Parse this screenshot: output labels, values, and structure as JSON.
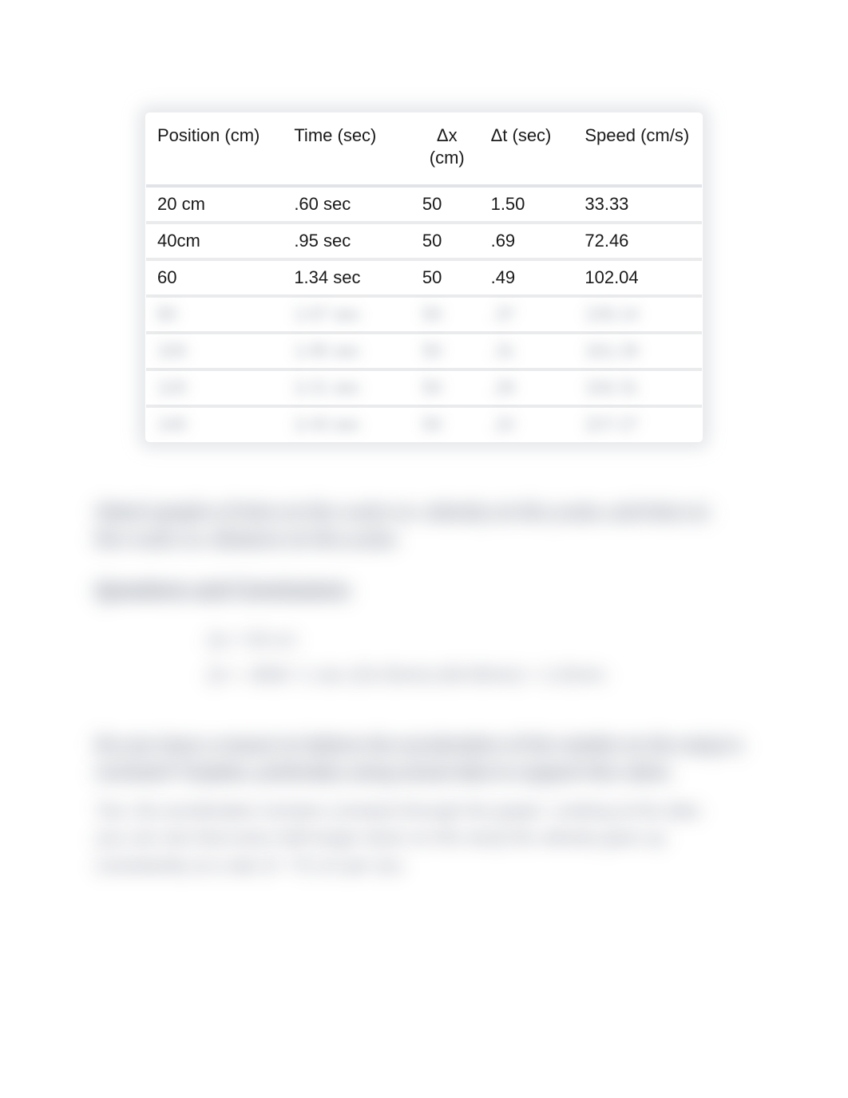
{
  "table": {
    "headers": [
      "Position (cm)",
      "Time (sec)",
      "Δx (cm)",
      "Δt (sec)",
      "Speed (cm/s)"
    ],
    "rows": [
      {
        "position": "20 cm",
        "time": ".60 sec",
        "dx": "50",
        "dt": "1.50",
        "speed": "33.33",
        "obscured": false
      },
      {
        "position": "40cm",
        "time": ".95 sec",
        "dx": "50",
        "dt": ".69",
        "speed": "72.46",
        "obscured": false
      },
      {
        "position": "60",
        "time": "1.34 sec",
        "dx": "50",
        "dt": ".49",
        "speed": "102.04",
        "obscured": false
      },
      {
        "position": "80",
        "time": "1.67 sec",
        "dx": "50",
        "dt": ".37",
        "speed": "135.14",
        "obscured": true
      },
      {
        "position": "100",
        "time": "1.95 sec",
        "dx": "50",
        "dt": ".31",
        "speed": "161.29",
        "obscured": true
      },
      {
        "position": "120",
        "time": "2.21 sec",
        "dx": "50",
        "dt": ".26",
        "speed": "192.31",
        "obscured": true
      },
      {
        "position": "140",
        "time": "2.43 sec",
        "dx": "50",
        "dt": ".22",
        "speed": "227.27",
        "obscured": true
      }
    ]
  },
  "paragraphs": {
    "p1_line1": "Attach graphs of time on the x-axis vs. velocity on the y-axis, and time on",
    "p1_line2": "the x-axis vs. distance on the y-axis.",
    "heading": "Questions and Conclusions",
    "indent1": "Δx = 50 cm",
    "indent2": "Δt = .4900 / 1 sec (33.33m/s) (60.90m/s) = 1.02m/s",
    "p2_line1": "Do you have a reason to believe the acceleration of the marble on the ramp is",
    "p2_line2": "constant?       Explain, preferably using           actual data      to support this claim.",
    "p3_line1": "Yes, the acceleration remains constant through the graph. Looking at the data",
    "p3_line2": "you can see that every half longer down on the ramp the velocity goes up",
    "p3_line3": "consistently at a rate of ~75 cm per sec."
  }
}
